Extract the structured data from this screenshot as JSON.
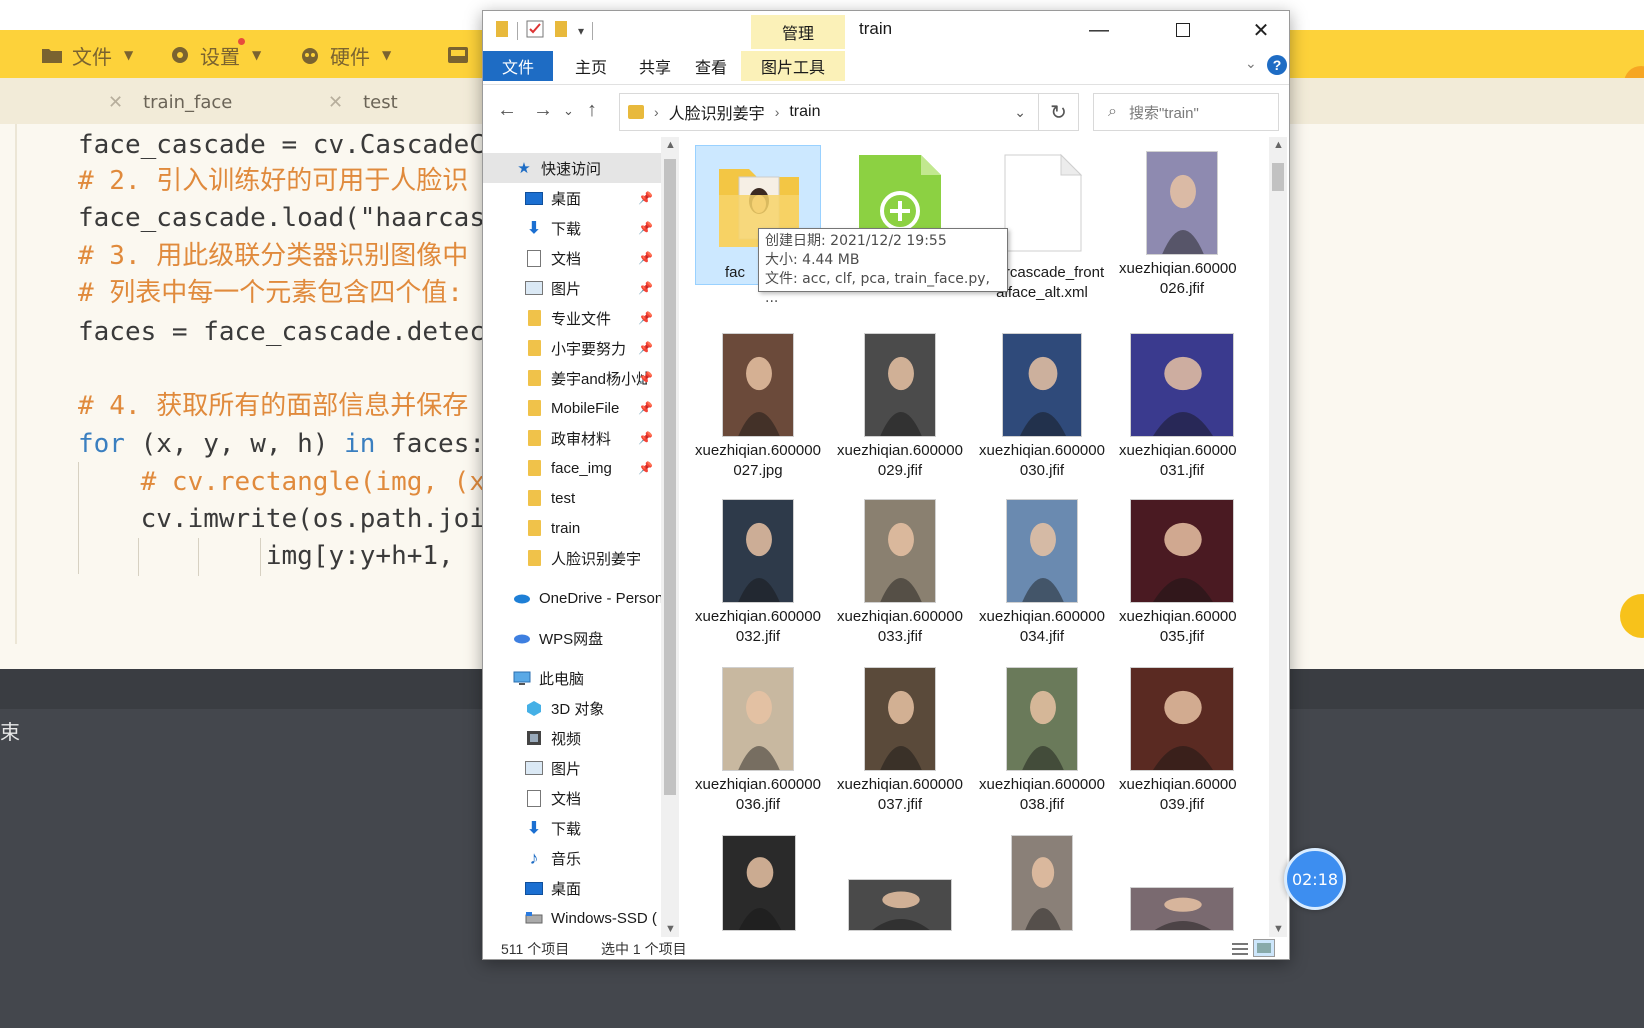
{
  "ide": {
    "toolbar": [
      {
        "label": "文件",
        "icon": "folder-icon"
      },
      {
        "label": "设置",
        "icon": "gear-icon"
      },
      {
        "label": "硬件",
        "icon": "hardware-icon"
      }
    ],
    "tabs": [
      "train_face",
      "test"
    ],
    "code_lines": [
      "face_cascade = cv.CascadeCl",
      "# 2. 引入训练好的可用于人脸识",
      "face_cascade.load(\"haarcasc",
      "# 3. 用此级联分类器识别图像中",
      "# 列表中每一个元素包含四个值:",
      "faces = face_cascade.detect",
      "",
      "# 4. 获取所有的面部信息并保存",
      "for (x, y, w, h) in faces:",
      "    # cv.rectangle(img, (x,",
      "    cv.imwrite(os.path.joir",
      "            img[y:y+h+1,"
    ],
    "terminal_text": "束"
  },
  "explorer": {
    "title": "train",
    "manage_tab": "管理",
    "ribbon_tabs": [
      "文件",
      "主页",
      "共享",
      "查看",
      "图片工具"
    ],
    "breadcrumb": [
      "人脸识别姜宇",
      "train"
    ],
    "search_placeholder": "搜索\"train\"",
    "nav_items": [
      {
        "label": "快速访问",
        "icon": "star-icon",
        "pinned": false,
        "selected": true
      },
      {
        "label": "桌面",
        "icon": "desktop-icon",
        "pinned": true
      },
      {
        "label": "下载",
        "icon": "download-icon",
        "pinned": true
      },
      {
        "label": "文档",
        "icon": "document-icon",
        "pinned": true
      },
      {
        "label": "图片",
        "icon": "pictures-icon",
        "pinned": true
      },
      {
        "label": "专业文件",
        "icon": "folder-icon",
        "pinned": true
      },
      {
        "label": "小宇要努力",
        "icon": "folder-icon",
        "pinned": true
      },
      {
        "label": "姜宇and杨小灿",
        "icon": "folder-icon",
        "pinned": true
      },
      {
        "label": "MobileFile",
        "icon": "folder-icon",
        "pinned": true
      },
      {
        "label": "政审材料",
        "icon": "folder-icon",
        "pinned": true
      },
      {
        "label": "face_img",
        "icon": "folder-icon",
        "pinned": true
      },
      {
        "label": "test",
        "icon": "folder-icon",
        "pinned": false
      },
      {
        "label": "train",
        "icon": "folder-icon",
        "pinned": false
      },
      {
        "label": "人脸识别姜宇",
        "icon": "folder-icon",
        "pinned": false
      },
      {
        "label": "OneDrive - Personal",
        "icon": "onedrive-icon",
        "pinned": false
      },
      {
        "label": "WPS网盘",
        "icon": "cloud-icon",
        "pinned": false
      },
      {
        "label": "此电脑",
        "icon": "computer-icon",
        "pinned": false
      },
      {
        "label": "3D 对象",
        "icon": "cube-icon",
        "pinned": false
      },
      {
        "label": "视频",
        "icon": "video-icon",
        "pinned": false
      },
      {
        "label": "图片",
        "icon": "pictures-icon",
        "pinned": false
      },
      {
        "label": "文档",
        "icon": "document-icon",
        "pinned": false
      },
      {
        "label": "下载",
        "icon": "download-icon",
        "pinned": false
      },
      {
        "label": "音乐",
        "icon": "music-icon",
        "pinned": false
      },
      {
        "label": "桌面",
        "icon": "desktop-icon",
        "pinned": false
      },
      {
        "label": "Windows-SSD (",
        "icon": "drive-icon",
        "pinned": false
      }
    ],
    "files": [
      {
        "name": "fac",
        "kind": "folder",
        "selected": true
      },
      {
        "name": "",
        "kind": "python"
      },
      {
        "name": "haarcascade_frontalface_alt.xml",
        "kind": "blank"
      },
      {
        "name": "xuezhiqian.600000026.jfif",
        "kind": "photo",
        "color": "#8e8ab0"
      },
      {
        "name": "xuezhiqian.600000027.jpg",
        "kind": "photo",
        "color": "#6b4a3a"
      },
      {
        "name": "xuezhiqian.600000029.jfif",
        "kind": "photo",
        "color": "#4b4b4b"
      },
      {
        "name": "xuezhiqian.600000030.jfif",
        "kind": "photo",
        "color": "#2f4a7a"
      },
      {
        "name": "xuezhiqian.600000031.jfif",
        "kind": "photo",
        "color": "#3a3a8e"
      },
      {
        "name": "xuezhiqian.600000032.jfif",
        "kind": "photo",
        "color": "#2e3a4a"
      },
      {
        "name": "xuezhiqian.600000033.jfif",
        "kind": "photo",
        "color": "#8a8070"
      },
      {
        "name": "xuezhiqian.600000034.jfif",
        "kind": "photo",
        "color": "#6a8ab0"
      },
      {
        "name": "xuezhiqian.600000035.jfif",
        "kind": "photo",
        "color": "#4a1a22"
      },
      {
        "name": "xuezhiqian.600000036.jfif",
        "kind": "photo",
        "color": "#c8b8a0"
      },
      {
        "name": "xuezhiqian.600000037.jfif",
        "kind": "photo",
        "color": "#5a4a3a"
      },
      {
        "name": "xuezhiqian.600000038.jfif",
        "kind": "photo",
        "color": "#6a7a5a"
      },
      {
        "name": "xuezhiqian.600000039.jfif",
        "kind": "photo",
        "color": "#5a2a22"
      },
      {
        "name": "",
        "kind": "photo",
        "color": "#2a2a2a"
      },
      {
        "name": "",
        "kind": "photo",
        "color": "#4a4a4a"
      },
      {
        "name": "",
        "kind": "photo",
        "color": "#8a8078"
      },
      {
        "name": "",
        "kind": "photo",
        "color": "#7a6a70"
      }
    ],
    "tooltip": {
      "created": "创建日期: 2021/12/2 19:55",
      "size": "大小: 4.44 MB",
      "files": "文件: acc, clf, pca, train_face.py, ..."
    },
    "status": {
      "count": "511 个项目",
      "selected": "选中 1 个项目"
    }
  },
  "timer": "02:18",
  "colors": {
    "ide_toolbar": "#fdd23a",
    "ribbon_file": "#1e6cc4",
    "manage_highlight": "#fbf1b8",
    "selection": "#cce8ff"
  }
}
